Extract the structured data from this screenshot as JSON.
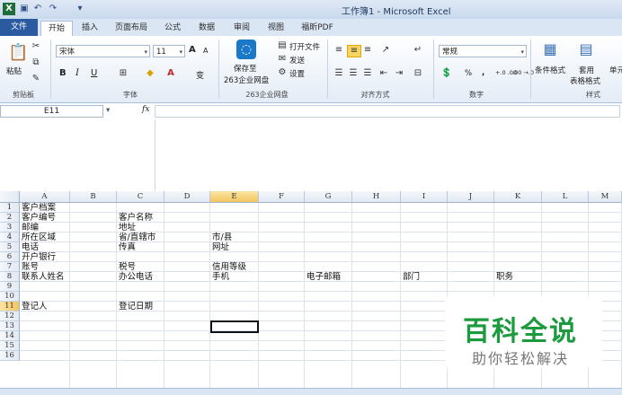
{
  "window": {
    "title": "工作簿1 - Microsoft Excel"
  },
  "tabs": [
    "文件",
    "开始",
    "插入",
    "页面布局",
    "公式",
    "数据",
    "审阅",
    "视图",
    "福昕PDF"
  ],
  "ribbon": {
    "clipboard": {
      "paste": "粘贴",
      "label": "剪贴板"
    },
    "font": {
      "name": "宋体",
      "size": "11",
      "grow": "A",
      "shrink": "A",
      "bold": "B",
      "italic": "I",
      "underline": "U",
      "phonetic": "变",
      "label": "字体"
    },
    "cloud": {
      "save": "保存至",
      "save2": "263企业网盘",
      "open": "打开文件",
      "send": "发送",
      "settings": "设置",
      "label": "263企业网盘"
    },
    "align": {
      "label": "对齐方式"
    },
    "number": {
      "format": "常规",
      "percent": "%",
      "comma": ",",
      "inc": "+.0 .00",
      "dec": ".00 →.0",
      "label": "数字"
    },
    "styles": {
      "cond": "条件格式",
      "table": "套用",
      "table2": "表格格式",
      "cell": "单元",
      "label": "样式"
    }
  },
  "formula": {
    "name_box": "E11",
    "fx": "fx"
  },
  "columns": [
    "A",
    "B",
    "C",
    "D",
    "E",
    "F",
    "G",
    "H",
    "I",
    "J",
    "K",
    "L",
    "M"
  ],
  "rows": [
    "1",
    "2",
    "3",
    "4",
    "5",
    "6",
    "7",
    "8",
    "9",
    "10",
    "11",
    "12",
    "13",
    "14",
    "15",
    "16"
  ],
  "cells": {
    "A1": "客户档案",
    "A2": "客户编号",
    "C2": "客户名称",
    "A3": "邮编",
    "C3": "地址",
    "A4": "所在区域",
    "C4": "省/直辖市",
    "E4": "市/县",
    "A5": "电话",
    "C5": "传真",
    "E5": "网址",
    "A6": "开户银行",
    "A7": "账号",
    "C7": "税号",
    "E7": "信用等级",
    "A8": "联系人姓名",
    "C8": "办公电话",
    "E8": "手机",
    "G8": "电子邮箱",
    "I8": "部门",
    "K8": "职务",
    "A11": "登记人",
    "C11": "登记日期"
  },
  "watermark": {
    "title": "百科全说",
    "subtitle": "助你轻松解决"
  }
}
